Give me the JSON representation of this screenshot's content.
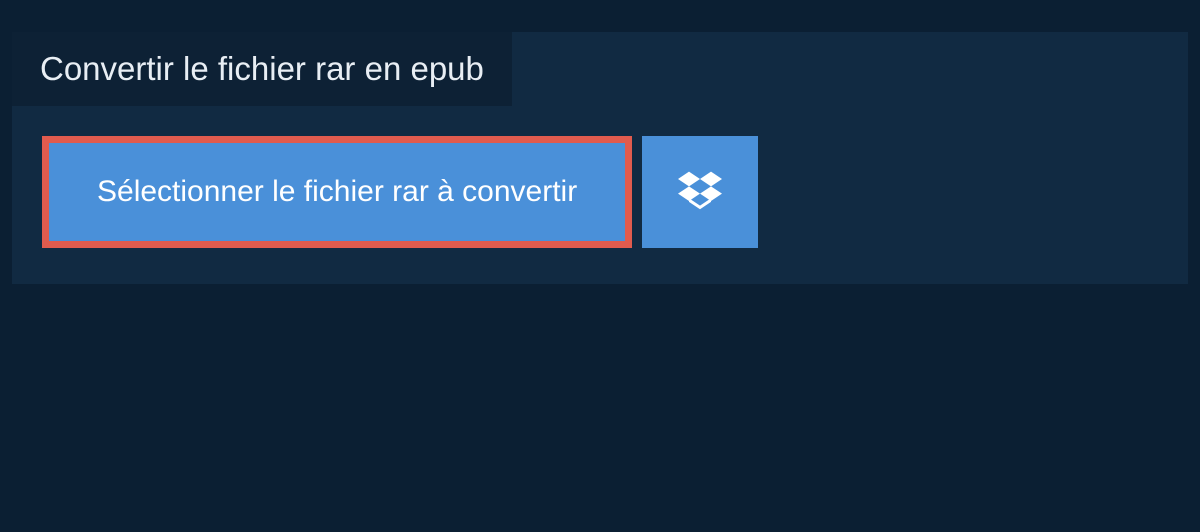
{
  "header": {
    "title": "Convertir le fichier rar en epub"
  },
  "actions": {
    "select_file_label": "Sélectionner le fichier rar à convertir"
  },
  "colors": {
    "page_bg": "#0b1f33",
    "panel_bg": "#112a42",
    "header_bg": "#0d2135",
    "button_bg": "#4a90d9",
    "button_text": "#ffffff",
    "highlight_border": "#e15b4e"
  }
}
